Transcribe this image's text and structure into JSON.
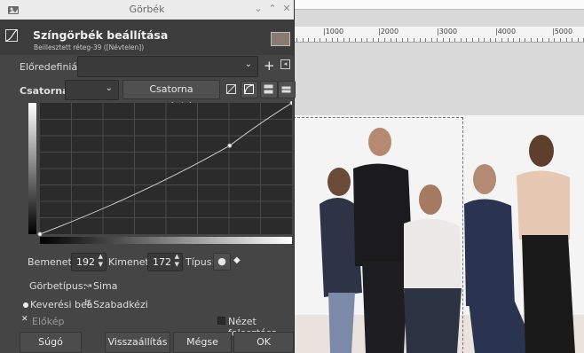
{
  "window": {
    "title": "Görbék"
  },
  "header": {
    "title": "Színgörbék beállítása",
    "subtitle": "Beillesztett réteg-39 ([Névtelen])"
  },
  "preset": {
    "label": "Előredefiniált:",
    "value": ""
  },
  "channel": {
    "label": "Csatorna:",
    "value": "",
    "reset_label": "Csatorna visszaállítása"
  },
  "curve": {
    "points": [
      {
        "input": 0,
        "output": 0
      },
      {
        "input": 192,
        "output": 172
      },
      {
        "input": 255,
        "output": 255
      }
    ]
  },
  "io": {
    "input_label": "Bemenet:",
    "input_value": "192",
    "output_label": "Kimenet:",
    "output_value": "172",
    "type_label": "Típus:"
  },
  "curve_type": {
    "label": "Görbetípus:",
    "smooth": "Sima",
    "freehand": "Szabadkézi"
  },
  "options": {
    "blend": "Keverési beá",
    "preview": "Előkép",
    "split_view": "Nézet felosztása"
  },
  "buttons": {
    "help": "Súgó",
    "reset": "Visszaállítás",
    "cancel": "Mégse",
    "ok": "OK"
  },
  "ruler": {
    "labels": [
      "|1000",
      "|2000",
      "|3000",
      "|4000",
      "|5000"
    ]
  },
  "colors": {
    "dialog_bg": "#454545",
    "accent": "#ffffff"
  }
}
